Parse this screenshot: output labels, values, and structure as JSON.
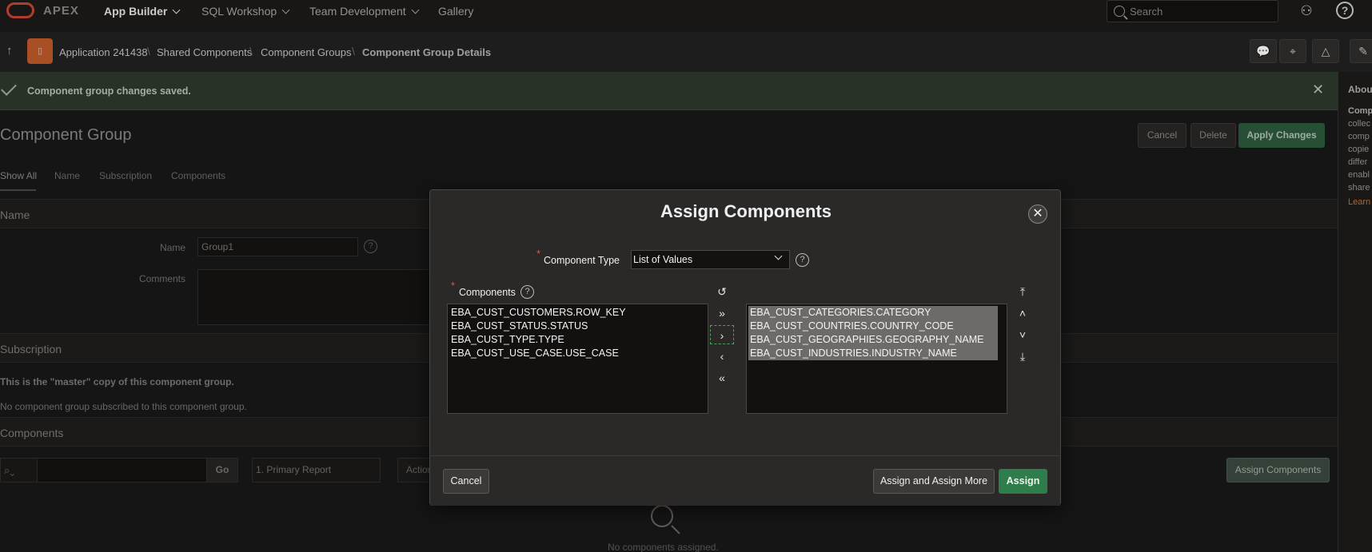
{
  "topbar": {
    "brand": "APEX",
    "nav": [
      {
        "label": "App Builder",
        "active": true
      },
      {
        "label": "SQL Workshop",
        "active": false
      },
      {
        "label": "Team Development",
        "active": false
      },
      {
        "label": "Gallery",
        "active": false
      }
    ],
    "search_placeholder": "Search",
    "icons": [
      "user-settings-icon",
      "help-icon"
    ]
  },
  "breadcrumb": {
    "items": [
      "Application 241438",
      "Shared Components",
      "Component Groups",
      "Component Group Details"
    ],
    "tools": [
      "comment-icon",
      "tag-icon",
      "shapes-icon",
      "edit-icon"
    ]
  },
  "banner": {
    "message": "Component group changes saved."
  },
  "help_panel": {
    "title": "About",
    "lines": [
      "Comp",
      "collec",
      "comp",
      "copie",
      "differ",
      "enabl",
      "share"
    ],
    "learn": "Learn"
  },
  "page": {
    "title": "Component Group",
    "buttons": {
      "cancel": "Cancel",
      "delete": "Delete",
      "apply": "Apply Changes"
    },
    "tabs": [
      "Show All",
      "Name",
      "Subscription",
      "Components"
    ],
    "sections": {
      "name": "Name",
      "subscription": "Subscription",
      "components": "Components"
    },
    "fields": {
      "name_label": "Name",
      "name_value": "Group1",
      "comments_label": "Comments"
    },
    "subscription_text": {
      "master": "This is the \"master\" copy of this component group.",
      "none": "No component group subscribed to this component group."
    },
    "report": {
      "go": "Go",
      "report_select": "1. Primary Report",
      "actions": "Actions",
      "assign_button": "Assign Components",
      "empty": "No components assigned."
    }
  },
  "modal": {
    "title": "Assign Components",
    "component_type_label": "Component Type",
    "component_type_value": "List of Values",
    "components_label": "Components",
    "available": [
      "EBA_CUST_CUSTOMERS.ROW_KEY",
      "EBA_CUST_STATUS.STATUS",
      "EBA_CUST_TYPE.TYPE",
      "EBA_CUST_USE_CASE.USE_CASE"
    ],
    "selected": [
      "EBA_CUST_CATEGORIES.CATEGORY",
      "EBA_CUST_COUNTRIES.COUNTRY_CODE",
      "EBA_CUST_GEOGRAPHIES.GEOGRAPHY_NAME",
      "EBA_CUST_INDUSTRIES.INDUSTRY_NAME"
    ],
    "shuttle_controls": [
      {
        "name": "reset-icon",
        "glyph": "↺"
      },
      {
        "name": "move-all-right-icon",
        "glyph": "»"
      },
      {
        "name": "move-right-icon",
        "glyph": "›"
      },
      {
        "name": "move-left-icon",
        "glyph": "‹"
      },
      {
        "name": "move-all-left-icon",
        "glyph": "«"
      }
    ],
    "order_controls": [
      {
        "name": "move-top-icon",
        "glyph": "⤒"
      },
      {
        "name": "move-up-icon",
        "glyph": "˄"
      },
      {
        "name": "move-down-icon",
        "glyph": "˅"
      },
      {
        "name": "move-bottom-icon",
        "glyph": "⤓"
      }
    ],
    "buttons": {
      "cancel": "Cancel",
      "assign_more": "Assign and Assign More",
      "assign": "Assign"
    }
  }
}
